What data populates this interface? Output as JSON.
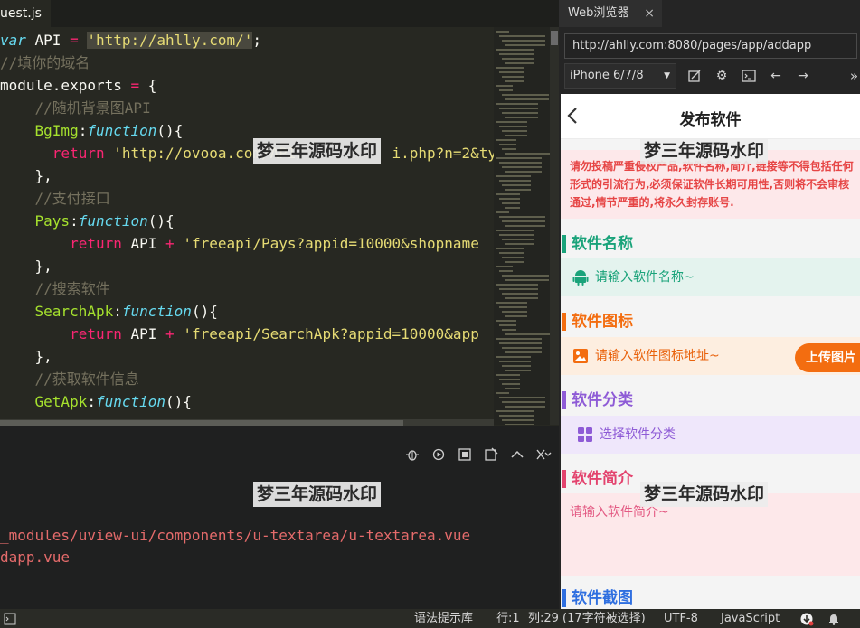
{
  "editor": {
    "tab_label": "uest.js",
    "code_lines": [
      {
        "indent": "",
        "parts": [
          {
            "t": "var",
            "c": "kw"
          },
          {
            "t": " API ",
            "c": ""
          },
          {
            "t": "=",
            "c": "op"
          },
          {
            "t": " ",
            "c": ""
          },
          {
            "t": "'http://ahlly.com/'",
            "c": "str sel"
          },
          {
            "t": ";",
            "c": ""
          }
        ]
      },
      {
        "indent": "",
        "parts": [
          {
            "t": "//填你的域名",
            "c": "cm"
          }
        ]
      },
      {
        "indent": "",
        "parts": [
          {
            "t": "module.exports ",
            "c": ""
          },
          {
            "t": "=",
            "c": "op"
          },
          {
            "t": " {",
            "c": ""
          }
        ]
      },
      {
        "indent": "    ",
        "parts": [
          {
            "t": "//随机背景图API",
            "c": "cm"
          }
        ]
      },
      {
        "indent": "    ",
        "parts": [
          {
            "t": "BgImg",
            "c": "prop"
          },
          {
            "t": ":",
            "c": ""
          },
          {
            "t": "function",
            "c": "kw"
          },
          {
            "t": "(){",
            "c": ""
          }
        ]
      },
      {
        "indent": "      ",
        "parts": [
          {
            "t": "return",
            "c": "op"
          },
          {
            "t": " ",
            "c": ""
          },
          {
            "t": "'http://ovooa.com/API/",
            "c": "str"
          },
          {
            "t": "          ",
            "c": ""
          },
          {
            "t": "i.php?n=2&ty",
            "c": "str"
          }
        ]
      },
      {
        "indent": "    ",
        "parts": [
          {
            "t": "},",
            "c": ""
          }
        ]
      },
      {
        "indent": "    ",
        "parts": [
          {
            "t": "//支付接口",
            "c": "cm"
          }
        ]
      },
      {
        "indent": "    ",
        "parts": [
          {
            "t": "Pays",
            "c": "prop"
          },
          {
            "t": ":",
            "c": ""
          },
          {
            "t": "function",
            "c": "kw"
          },
          {
            "t": "(){",
            "c": ""
          }
        ]
      },
      {
        "indent": "        ",
        "parts": [
          {
            "t": "return",
            "c": "op"
          },
          {
            "t": " API ",
            "c": ""
          },
          {
            "t": "+",
            "c": "op"
          },
          {
            "t": " ",
            "c": ""
          },
          {
            "t": "'freeapi/Pays?appid=10000&shopname",
            "c": "str"
          }
        ]
      },
      {
        "indent": "    ",
        "parts": [
          {
            "t": "},",
            "c": ""
          }
        ]
      },
      {
        "indent": "    ",
        "parts": [
          {
            "t": "//搜索软件",
            "c": "cm"
          }
        ]
      },
      {
        "indent": "    ",
        "parts": [
          {
            "t": "SearchApk",
            "c": "prop"
          },
          {
            "t": ":",
            "c": ""
          },
          {
            "t": "function",
            "c": "kw"
          },
          {
            "t": "(){",
            "c": ""
          }
        ]
      },
      {
        "indent": "        ",
        "parts": [
          {
            "t": "return",
            "c": "op"
          },
          {
            "t": " API ",
            "c": ""
          },
          {
            "t": "+",
            "c": "op"
          },
          {
            "t": " ",
            "c": ""
          },
          {
            "t": "'freeapi/SearchApk?appid=10000&app",
            "c": "str"
          }
        ]
      },
      {
        "indent": "    ",
        "parts": [
          {
            "t": "},",
            "c": ""
          }
        ]
      },
      {
        "indent": "    ",
        "parts": [
          {
            "t": "//获取软件信息",
            "c": "cm"
          }
        ]
      },
      {
        "indent": "    ",
        "parts": [
          {
            "t": "GetApk",
            "c": "prop"
          },
          {
            "t": ":",
            "c": ""
          },
          {
            "t": "function",
            "c": "kw"
          },
          {
            "t": "(){",
            "c": ""
          }
        ]
      }
    ]
  },
  "console": {
    "lines": [
      "_modules/uview-ui/components/u-textarea/u-textarea.vue",
      "dapp.vue"
    ],
    "tools": [
      "bug-icon",
      "restart-icon",
      "stop-icon",
      "clear-icon",
      "collapse-icon",
      "close-console-icon"
    ]
  },
  "watermark": "梦三年源码水印",
  "browser": {
    "tab_label": "Web浏览器",
    "tab_close": "×",
    "url": "http://ahlly.com:8080/pages/app/addapp",
    "device": "iPhone 6/7/8",
    "more": "»"
  },
  "app": {
    "title": "发布软件",
    "notice": "请勿投稿严重侵权产品,软件名称,简介,链接等不得包括任何形式的引流行为,必须保证软件长期可用性,否则将不会审核通过,情节严重的,将永久封存账号.",
    "sections": {
      "name": {
        "title": "软件名称",
        "placeholder": "请输入软件名称~"
      },
      "icon": {
        "title": "软件图标",
        "placeholder": "请输入软件图标地址~",
        "button": "上传图片"
      },
      "category": {
        "title": "软件分类",
        "placeholder": "选择软件分类"
      },
      "intro": {
        "title": "软件简介",
        "placeholder": "请输入软件简介~"
      },
      "screenshots": {
        "title": "软件截图"
      }
    },
    "colors": {
      "name": "#1aa37a",
      "icon": "#f36d10",
      "category": "#8e5bd6",
      "intro": "#e3436e",
      "screenshots": "#2f6fe0"
    }
  },
  "statusbar": {
    "hint_lib": "语法提示库",
    "cursor": "行:1",
    "column": "列:29 (17字符被选择)",
    "encoding": "UTF-8",
    "language": "JavaScript"
  }
}
